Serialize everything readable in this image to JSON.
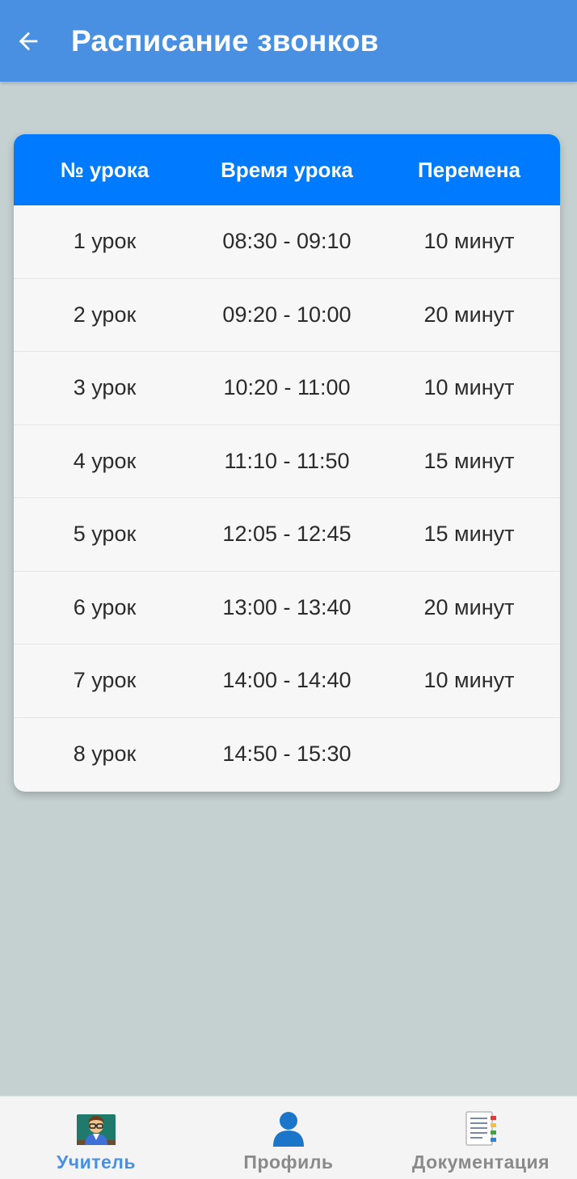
{
  "app_bar": {
    "title": "Расписание звонков",
    "back_icon": "arrow-left-icon"
  },
  "schedule": {
    "headers": [
      "№ урока",
      "Время урока",
      "Перемена"
    ],
    "rows": [
      {
        "lesson": "1 урок",
        "time": "08:30 - 09:10",
        "break": "10 минут"
      },
      {
        "lesson": "2 урок",
        "time": "09:20 - 10:00",
        "break": "20 минут"
      },
      {
        "lesson": "3 урок",
        "time": "10:20 - 11:00",
        "break": "10 минут"
      },
      {
        "lesson": "4 урок",
        "time": "11:10 - 11:50",
        "break": "15 минут"
      },
      {
        "lesson": "5 урок",
        "time": "12:05 - 12:45",
        "break": "15 минут"
      },
      {
        "lesson": "6 урок",
        "time": "13:00 - 13:40",
        "break": "20 минут"
      },
      {
        "lesson": "7 урок",
        "time": "14:00 - 14:40",
        "break": "10 минут"
      },
      {
        "lesson": "8 урок",
        "time": "14:50 - 15:30",
        "break": ""
      }
    ]
  },
  "bottom_nav": {
    "items": [
      {
        "label": "Учитель",
        "icon": "teacher-icon",
        "active": true
      },
      {
        "label": "Профиль",
        "icon": "profile-icon",
        "active": false
      },
      {
        "label": "Документация",
        "icon": "document-icon",
        "active": false
      }
    ]
  },
  "colors": {
    "app_bar": "#4a90e2",
    "table_header": "#007bff",
    "background": "#c5d1d1",
    "active_nav": "#4a90e2"
  }
}
